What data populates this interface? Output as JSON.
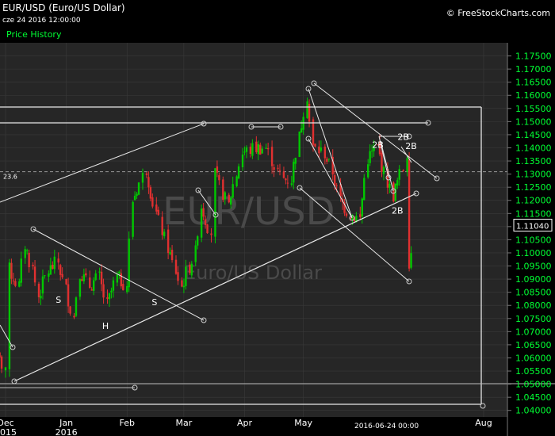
{
  "header": {
    "title": "EUR/USD (Euro/US Dollar)",
    "timestamp": "cze 24 2016 12:00:00",
    "panel_label": "Price History",
    "credit": "© FreeStockCharts.com"
  },
  "watermark": {
    "symbol": "EUR/USD",
    "name": "Euro/US Dollar"
  },
  "colors": {
    "up": "#00c800",
    "down": "#e03030",
    "axis_text": "#00ff33",
    "plot_bg": "#262626",
    "grid": "#3a3a3a",
    "drawing": "#e8e8e8"
  },
  "chart_data": {
    "type": "candlestick",
    "symbol": "EUR/USD",
    "ylim": [
      1.0375,
      1.18
    ],
    "y_ticks": [
      "1.04000",
      "1.04500",
      "1.05000",
      "1.05500",
      "1.06000",
      "1.06500",
      "1.07000",
      "1.07500",
      "1.08000",
      "1.08500",
      "1.09000",
      "1.09500",
      "1.10000",
      "1.10500",
      "1.11000",
      "1.11500",
      "1.12000",
      "1.12500",
      "1.13000",
      "1.13500",
      "1.14000",
      "1.14500",
      "1.15000",
      "1.15500",
      "1.16000",
      "1.16500",
      "1.17000",
      "1.17500"
    ],
    "x_ticks": [
      {
        "label": "Dec",
        "year": "2015",
        "date": "2015-12-01"
      },
      {
        "label": "Jan",
        "year": "2016",
        "date": "2016-01-01"
      },
      {
        "label": "Feb",
        "date": "2016-02-01"
      },
      {
        "label": "Mar",
        "date": "2016-03-01"
      },
      {
        "label": "Apr",
        "date": "2016-04-01"
      },
      {
        "label": "May",
        "date": "2016-05-01"
      },
      {
        "label": "Aug",
        "date": "2016-08-01"
      }
    ],
    "cursor_date": "2016-06-24 00:00",
    "last_price": "1.11040",
    "last_price_value": 1.1104,
    "side_label": "23.6",
    "side_level": 1.1309,
    "series": [
      {
        "date": "2015-11-24",
        "close": 1.0645
      },
      {
        "date": "2015-11-27",
        "close": 1.0595
      },
      {
        "date": "2015-12-01",
        "close": 1.0565
      },
      {
        "date": "2015-12-03",
        "close": 1.0935
      },
      {
        "date": "2015-12-08",
        "close": 1.0875
      },
      {
        "date": "2015-12-11",
        "close": 1.103
      },
      {
        "date": "2015-12-15",
        "close": 1.094
      },
      {
        "date": "2015-12-18",
        "close": 1.0835
      },
      {
        "date": "2015-12-23",
        "close": 1.093
      },
      {
        "date": "2015-12-28",
        "close": 1.0965
      },
      {
        "date": "2016-01-05",
        "close": 1.0755
      },
      {
        "date": "2016-01-08",
        "close": 1.093
      },
      {
        "date": "2016-01-13",
        "close": 1.0875
      },
      {
        "date": "2016-01-18",
        "close": 1.0905
      },
      {
        "date": "2016-01-22",
        "close": 1.08
      },
      {
        "date": "2016-01-27",
        "close": 1.0905
      },
      {
        "date": "2016-02-01",
        "close": 1.088
      },
      {
        "date": "2016-02-04",
        "close": 1.12
      },
      {
        "date": "2016-02-09",
        "close": 1.129
      },
      {
        "date": "2016-02-11",
        "close": 1.132
      },
      {
        "date": "2016-02-16",
        "close": 1.115
      },
      {
        "date": "2016-02-22",
        "close": 1.102
      },
      {
        "date": "2016-02-29",
        "close": 1.087
      },
      {
        "date": "2016-03-07",
        "close": 1.1
      },
      {
        "date": "2016-03-10",
        "close": 1.118
      },
      {
        "date": "2016-03-15",
        "close": 1.108
      },
      {
        "date": "2016-03-17",
        "close": 1.13
      },
      {
        "date": "2016-03-24",
        "close": 1.118
      },
      {
        "date": "2016-03-31",
        "close": 1.138
      },
      {
        "date": "2016-04-07",
        "close": 1.14
      },
      {
        "date": "2016-04-12",
        "close": 1.14
      },
      {
        "date": "2016-04-18",
        "close": 1.131
      },
      {
        "date": "2016-04-21",
        "close": 1.128
      },
      {
        "date": "2016-04-25",
        "close": 1.128
      },
      {
        "date": "2016-04-29",
        "close": 1.144
      },
      {
        "date": "2016-05-03",
        "close": 1.16
      },
      {
        "date": "2016-05-06",
        "close": 1.14
      },
      {
        "date": "2016-05-12",
        "close": 1.138
      },
      {
        "date": "2016-05-16",
        "close": 1.131
      },
      {
        "date": "2016-05-20",
        "close": 1.12
      },
      {
        "date": "2016-05-25",
        "close": 1.115
      },
      {
        "date": "2016-05-30",
        "close": 1.113
      },
      {
        "date": "2016-06-03",
        "close": 1.136
      },
      {
        "date": "2016-06-08",
        "close": 1.14
      },
      {
        "date": "2016-06-13",
        "close": 1.127
      },
      {
        "date": "2016-06-16",
        "close": 1.122
      },
      {
        "date": "2016-06-21",
        "close": 1.132
      },
      {
        "date": "2016-06-23",
        "close": 1.138
      },
      {
        "date": "2016-06-24",
        "close": 1.097
      },
      {
        "date": "2016-06-27",
        "close": 1.104
      }
    ],
    "annotations": [
      {
        "text": "S",
        "date": "2015-12-28",
        "value": 1.081
      },
      {
        "text": "H",
        "date": "2016-01-21",
        "value": 1.071
      },
      {
        "text": "S",
        "date": "2016-02-15",
        "value": 1.08
      },
      {
        "text": "2B",
        "date": "2016-06-08",
        "value": 1.14
      },
      {
        "text": "2B",
        "date": "2016-06-21",
        "value": 1.143
      },
      {
        "text": "2B",
        "date": "2016-06-25",
        "value": 1.1395
      },
      {
        "text": "2B",
        "date": "2016-06-18",
        "value": 1.115
      }
    ]
  }
}
